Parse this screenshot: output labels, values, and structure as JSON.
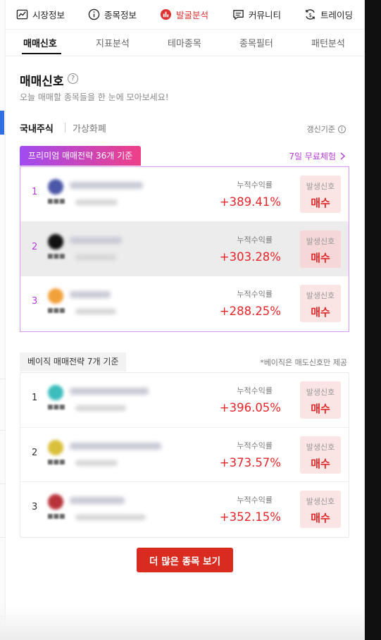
{
  "top_nav": [
    {
      "label": "시장정보",
      "icon": "chart-icon"
    },
    {
      "label": "종목정보",
      "icon": "info-circle-icon"
    },
    {
      "label": "발굴분석",
      "icon": "bar-chart-icon",
      "active": true
    },
    {
      "label": "커뮤니티",
      "icon": "chat-icon"
    },
    {
      "label": "트레이딩",
      "icon": "trading-icon"
    }
  ],
  "sub_tabs": [
    {
      "label": "매매신호",
      "active": true
    },
    {
      "label": "지표분석"
    },
    {
      "label": "테마종목"
    },
    {
      "label": "종목필터"
    },
    {
      "label": "패턴분석"
    }
  ],
  "page": {
    "title": "매매신호",
    "subtitle": "오늘 매매할 종목들을 한 눈에 모아보세요!",
    "help_icon": "question-icon"
  },
  "market_tabs": {
    "active": "국내주식",
    "inactive": "가상화폐",
    "update_basis": "갱신기준"
  },
  "premium": {
    "badge": "프리미엄 매매전략 36개 기준",
    "free_trial": "7일 무료체험",
    "rows": [
      {
        "rank": "1",
        "return_label": "누적수익률",
        "return": "+389.41%",
        "signal_label": "발생신호",
        "signal": "매수",
        "highlight": false
      },
      {
        "rank": "2",
        "return_label": "누적수익률",
        "return": "+303.28%",
        "signal_label": "발생신호",
        "signal": "매수",
        "highlight": true
      },
      {
        "rank": "3",
        "return_label": "누적수익률",
        "return": "+288.25%",
        "signal_label": "발생신호",
        "signal": "매수",
        "highlight": false
      }
    ]
  },
  "basic": {
    "badge": "베이직 매매전략 7개 기준",
    "note": "*베이직은 매도신호만 제공",
    "rows": [
      {
        "rank": "1",
        "return_label": "누적수익률",
        "return": "+396.05%",
        "signal_label": "발생신호",
        "signal": "매수",
        "highlight": false
      },
      {
        "rank": "2",
        "return_label": "누적수익률",
        "return": "+373.57%",
        "signal_label": "발생신호",
        "signal": "매수",
        "highlight": false
      },
      {
        "rank": "3",
        "return_label": "누적수익률",
        "return": "+352.15%",
        "signal_label": "발생신호",
        "signal": "매수",
        "highlight": false
      }
    ]
  },
  "more_button": "더 많은 종목 보기",
  "colors": {
    "accent_red": "#e5252a",
    "button_red": "#d92b1f",
    "premium_purple": "#b53dd6",
    "premium_gradient_start": "#a14cf0",
    "premium_gradient_end": "#ee3f88"
  }
}
